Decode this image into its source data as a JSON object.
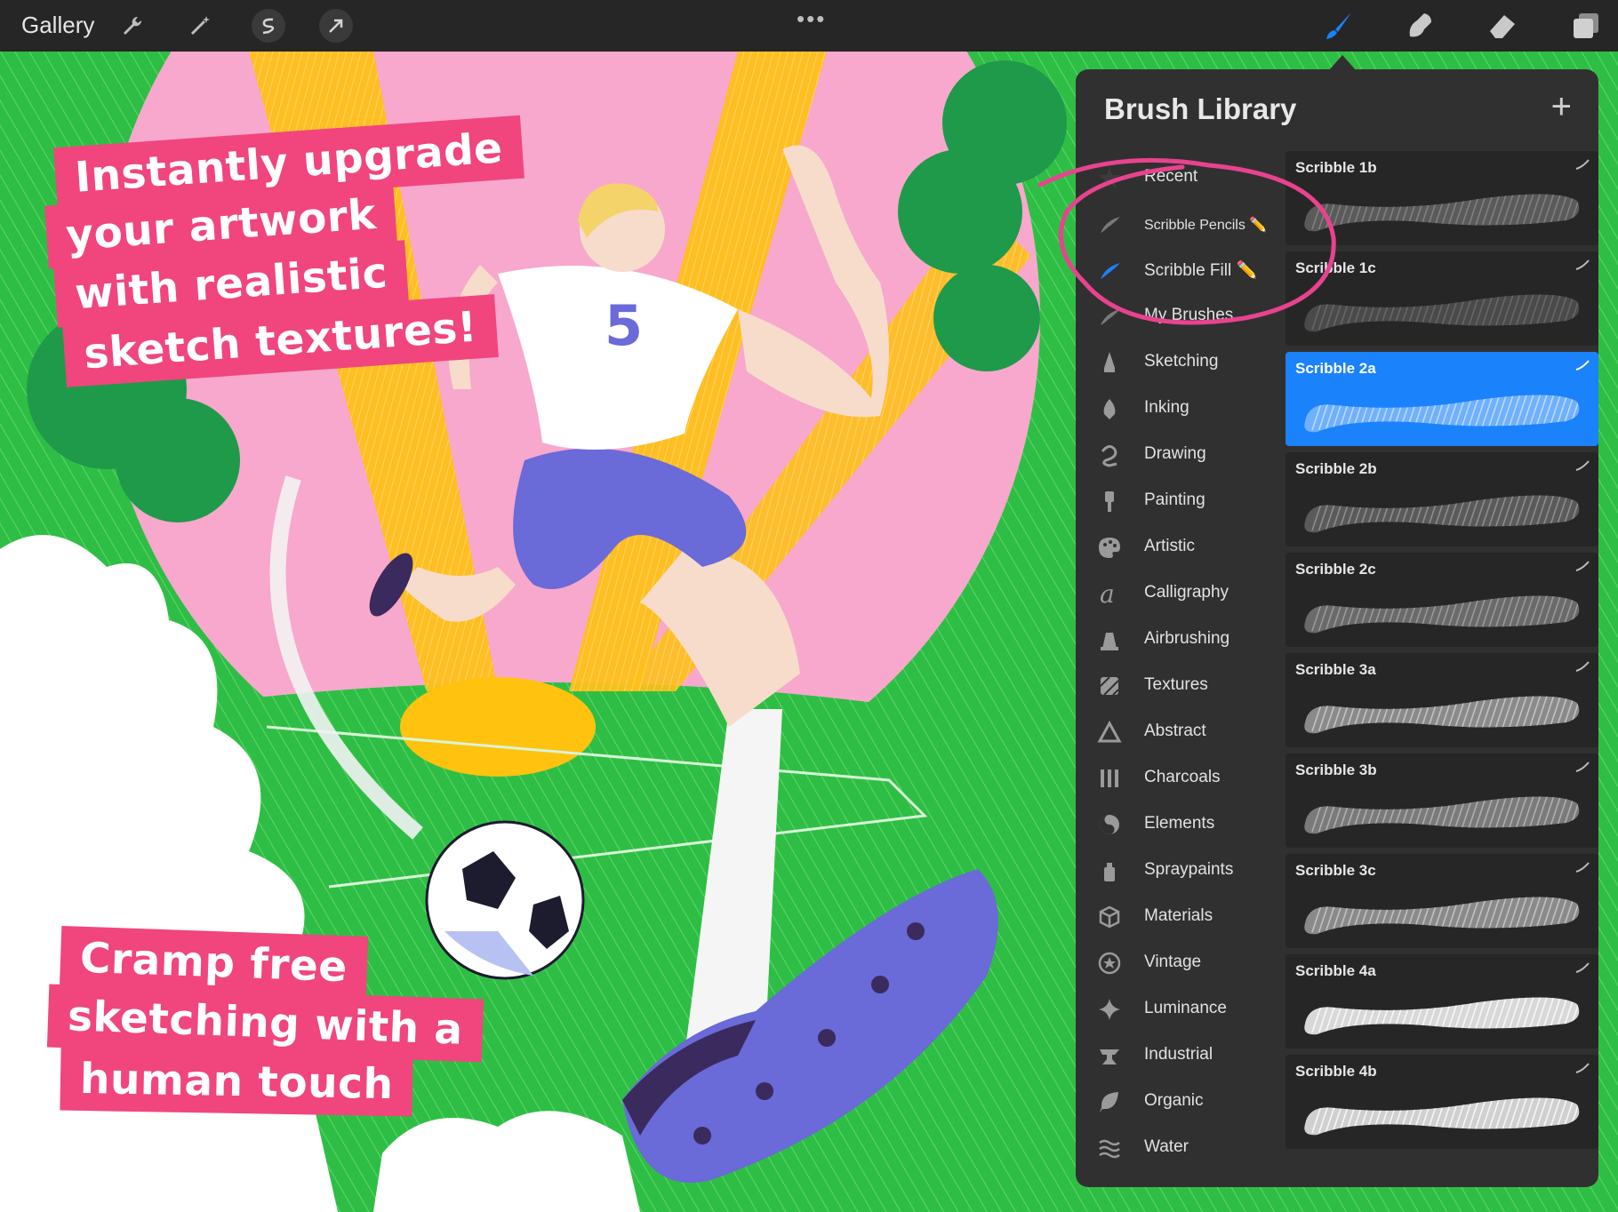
{
  "toolbar": {
    "gallery_label": "Gallery",
    "more_label": "•••",
    "left_tools": [
      "wrench-icon",
      "magic-wand-icon",
      "selection-icon",
      "transform-arrow-icon"
    ],
    "right_tools": [
      "brush-icon",
      "smudge-icon",
      "eraser-icon",
      "layers-icon"
    ],
    "active_color": "#1a82fb"
  },
  "artwork": {
    "banner_top": [
      "Instantly upgrade",
      "your artwork",
      "with realistic",
      "sketch textures!"
    ],
    "banner_bottom": [
      "Cramp free",
      "sketching with a",
      "human touch"
    ],
    "shirt_number": "5",
    "colors": {
      "grass": "#2fbe45",
      "sky_pink": "#f7a8cc",
      "banner": "#f1457d",
      "shorts": "#6a6ad8",
      "sun": "#ffc20e"
    }
  },
  "brush_library": {
    "title": "Brush Library",
    "add_label": "+",
    "sets": [
      {
        "label": "Recent",
        "icon": "star-icon"
      },
      {
        "label": "Scribble Pencils ✏️",
        "icon": "brush-set-icon"
      },
      {
        "label": "Scribble Fill ✏️",
        "icon": "brush-set-icon"
      },
      {
        "label": "My Brushes",
        "icon": "brush-set-icon"
      },
      {
        "label": "Sketching",
        "icon": "pencil-tip-icon"
      },
      {
        "label": "Inking",
        "icon": "pen-nib-icon"
      },
      {
        "label": "Drawing",
        "icon": "squiggle-icon"
      },
      {
        "label": "Painting",
        "icon": "paint-brush-icon"
      },
      {
        "label": "Artistic",
        "icon": "palette-icon"
      },
      {
        "label": "Calligraphy",
        "icon": "calligraphy-a-icon"
      },
      {
        "label": "Airbrushing",
        "icon": "airbrush-icon"
      },
      {
        "label": "Textures",
        "icon": "texture-icon"
      },
      {
        "label": "Abstract",
        "icon": "triangle-icon"
      },
      {
        "label": "Charcoals",
        "icon": "charcoal-icon"
      },
      {
        "label": "Elements",
        "icon": "yin-yang-icon"
      },
      {
        "label": "Spraypaints",
        "icon": "spray-can-icon"
      },
      {
        "label": "Materials",
        "icon": "cube-icon"
      },
      {
        "label": "Vintage",
        "icon": "vintage-star-icon"
      },
      {
        "label": "Luminance",
        "icon": "sparkle-icon"
      },
      {
        "label": "Industrial",
        "icon": "anvil-icon"
      },
      {
        "label": "Organic",
        "icon": "leaf-icon"
      },
      {
        "label": "Water",
        "icon": "waves-icon"
      }
    ],
    "active_set": "Scribble Fill ✏️",
    "brushes": [
      {
        "name": "Scribble 1b"
      },
      {
        "name": "Scribble 1c"
      },
      {
        "name": "Scribble 2a"
      },
      {
        "name": "Scribble 2b"
      },
      {
        "name": "Scribble 2c"
      },
      {
        "name": "Scribble 3a"
      },
      {
        "name": "Scribble 3b"
      },
      {
        "name": "Scribble 3c"
      },
      {
        "name": "Scribble 4a"
      },
      {
        "name": "Scribble 4b"
      }
    ],
    "active_brush": "Scribble 2a",
    "annotation_color": "#e8438f"
  }
}
